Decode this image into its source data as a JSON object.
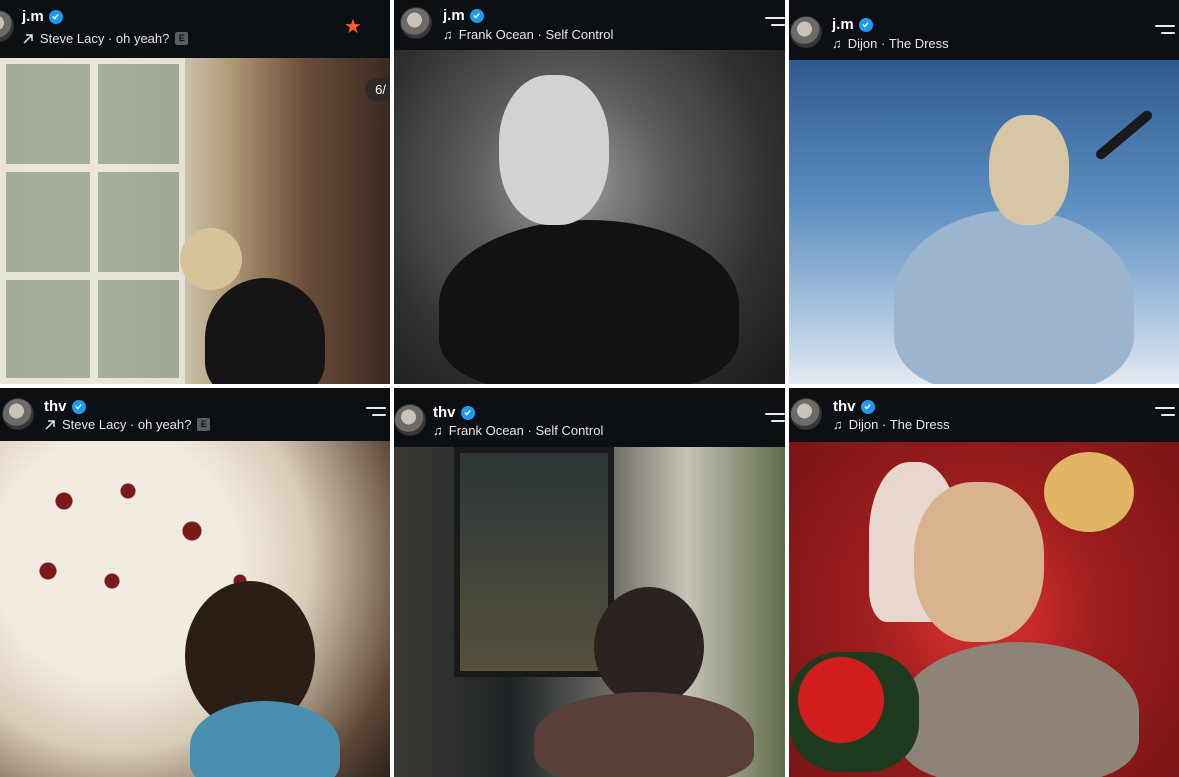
{
  "posts": [
    {
      "username": "j.m",
      "track_icon": "arrow-up-right-icon",
      "track": "Steve Lacy · oh yeah?",
      "explicit": "E",
      "counter": "6/"
    },
    {
      "username": "j.m",
      "track_icon": "music-note-icon",
      "track": "Frank Ocean · Self Control"
    },
    {
      "username": "j.m",
      "track_icon": "music-note-icon",
      "track": "Dijon · The Dress"
    },
    {
      "username": "thv",
      "track_icon": "arrow-up-right-icon",
      "track": "Steve Lacy · oh yeah?",
      "explicit": "E"
    },
    {
      "username": "thv",
      "track_icon": "music-note-icon",
      "track": "Frank Ocean · Self Control"
    },
    {
      "username": "thv",
      "track_icon": "music-note-icon",
      "track": "Dijon · The Dress"
    }
  ],
  "colors": {
    "header_bg": "#0c0f14",
    "verified": "#1d9bf0",
    "star": "#ff5a2b"
  }
}
